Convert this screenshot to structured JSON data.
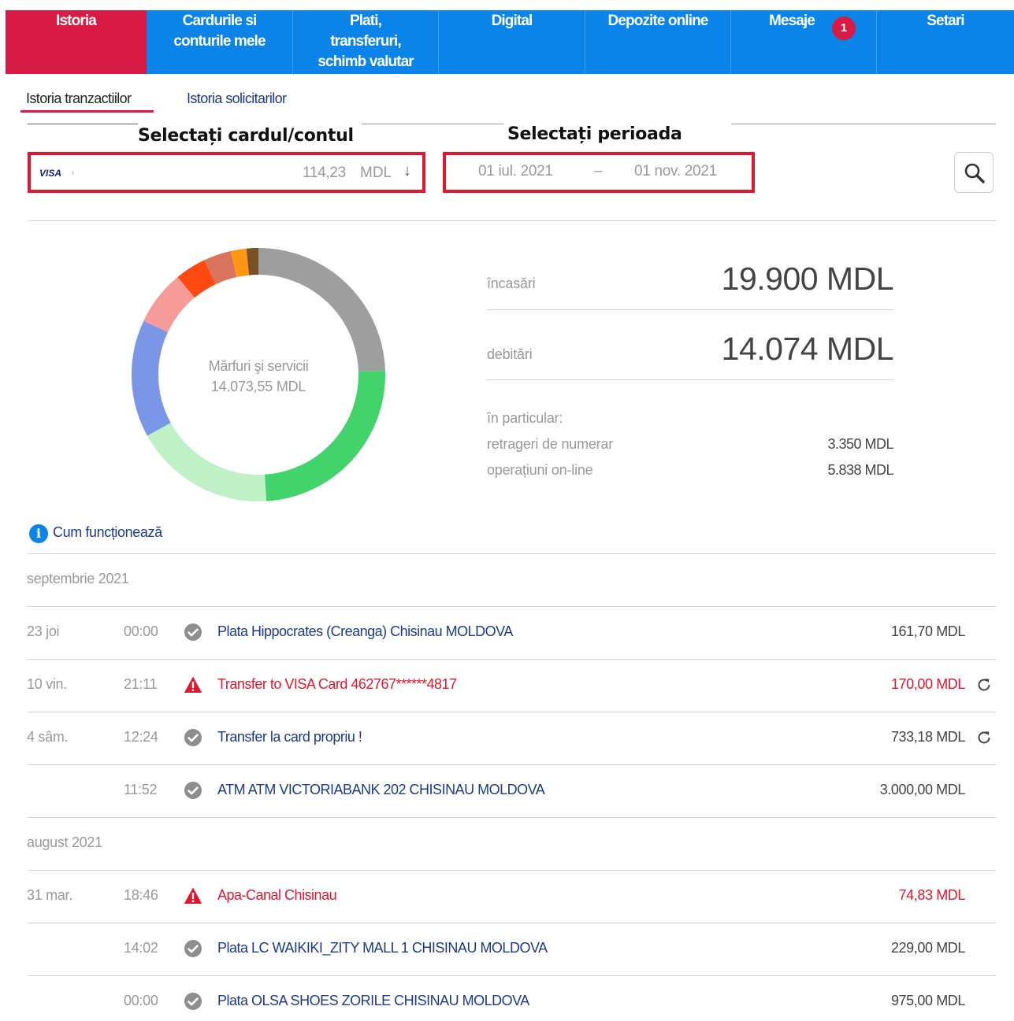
{
  "nav": {
    "items": [
      {
        "label": "Istoria"
      },
      {
        "label": "Cardurile si conturile mele"
      },
      {
        "label": "Plati, transferuri, schimb valutar"
      },
      {
        "label": "Digital"
      },
      {
        "label": "Depozite online"
      },
      {
        "label": "Mesaje",
        "badge": "1"
      },
      {
        "label": "Setari"
      }
    ],
    "active_color": "#d81b44",
    "bg_color": "#0a84e8"
  },
  "subtabs": {
    "active": "Istoria tranzactiilor",
    "inactive": "Istoria solicitarilor"
  },
  "labels": {
    "select_card": "Selectați cardul/contul",
    "select_period": "Selectați perioada"
  },
  "card_select": {
    "brand": "VISA",
    "brand_sub": "‹",
    "amount": "114,23",
    "currency": "MDL",
    "arrow": "↓"
  },
  "period": {
    "from": "01 iul. 2021",
    "separator": "–",
    "to": "01 nov. 2021"
  },
  "search": {
    "icon": "search-icon"
  },
  "chart_data": {
    "type": "pie",
    "center_label": "Mărfuri şi servicii",
    "center_value": "14.073,55   MDL",
    "slices": [
      {
        "color": "#9e9e9e",
        "value": 24.5
      },
      {
        "color": "#43d36b",
        "value": 24.5
      },
      {
        "color": "#bff0c6",
        "value": 18
      },
      {
        "color": "#7b96e6",
        "value": 15
      },
      {
        "color": "#f79a9a",
        "value": 7
      },
      {
        "color": "#ff4a0f",
        "value": 4
      },
      {
        "color": "#d9745c",
        "value": 3.5
      },
      {
        "color": "#ff9513",
        "value": 2
      },
      {
        "color": "#7a5025",
        "value": 1.5
      }
    ]
  },
  "summary": {
    "income_label": "încasări",
    "income_value": "19.900 MDL",
    "debit_label": "debitări",
    "debit_value": "14.074 MDL",
    "particular_label": "în particular:",
    "cash_label": "retrageri de numerar",
    "cash_value": "3.350 MDL",
    "online_label": "operațiuni on-line",
    "online_value": "5.838 MDL"
  },
  "how_it_works": {
    "icon": "info-icon",
    "label": "Cum funcționează"
  },
  "months": [
    {
      "label": "septembrie 2021",
      "transactions": [
        {
          "day": "23 joi",
          "time": "00:00",
          "status": "ok",
          "desc": "Plata Hippocrates (Creanga) Chisinau MOLDOVA",
          "amount": "161,70 MDL",
          "repeat": false
        },
        {
          "day": "10 vin.",
          "time": "21:11",
          "status": "warn",
          "desc": "Transfer to VISA Card 462767******4817",
          "amount": "170,00 MDL",
          "repeat": true
        },
        {
          "day": "4 sâm.",
          "time": "12:24",
          "status": "ok",
          "desc": "Transfer la card propriu !",
          "amount": "733,18 MDL",
          "repeat": true
        },
        {
          "day": "",
          "time": "11:52",
          "status": "ok",
          "desc": "ATM ATM VICTORIABANK 202 CHISINAU MOLDOVA",
          "amount": "3.000,00 MDL",
          "repeat": false
        }
      ]
    },
    {
      "label": "august 2021",
      "transactions": [
        {
          "day": "31 mar.",
          "time": "18:46",
          "status": "warn",
          "desc": "Apa-Canal Chisinau",
          "amount": "74,83 MDL",
          "repeat": false
        },
        {
          "day": "",
          "time": "14:02",
          "status": "ok",
          "desc": "Plata LC WAIKIKI_ZITY MALL 1 CHISINAU MOLDOVA",
          "amount": "229,00 MDL",
          "repeat": false
        },
        {
          "day": "",
          "time": "00:00",
          "status": "ok",
          "desc": "Plata OLSA SHOES ZORILE CHISINAU MOLDOVA",
          "amount": "975,00 MDL",
          "repeat": false
        }
      ]
    }
  ]
}
